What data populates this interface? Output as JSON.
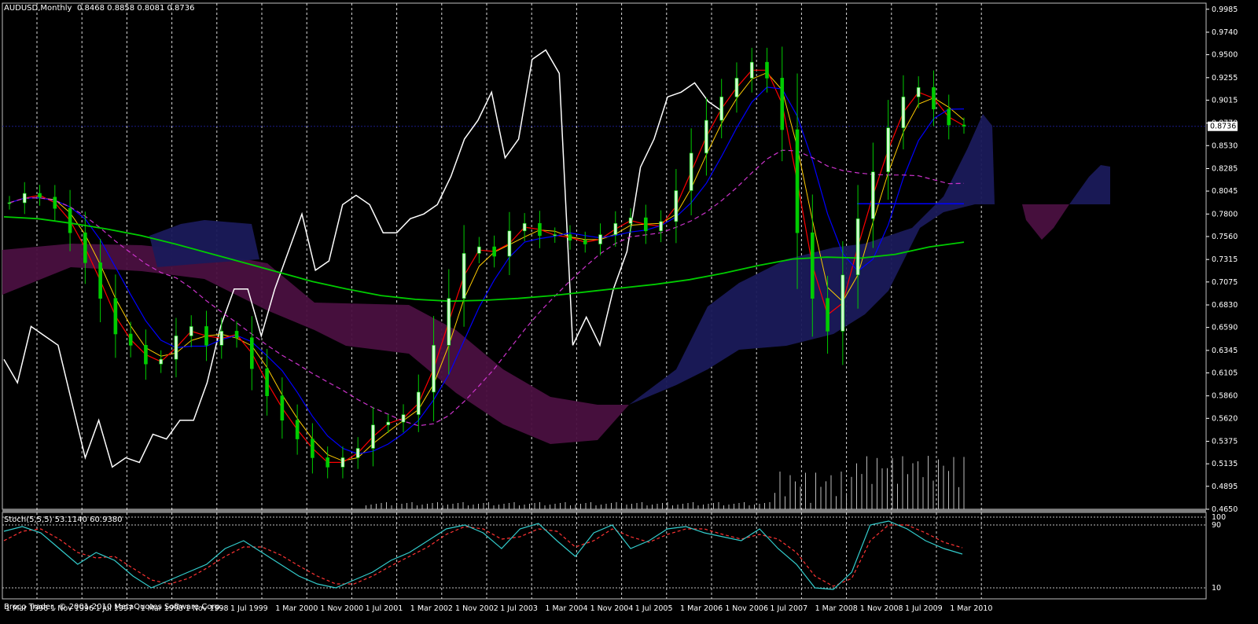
{
  "window": {
    "symbol_label": "AUDUSD,Monthly",
    "ohlc_label": "0.8468 0.8858 0.8081 0.8736",
    "current_price_label": "0.8736",
    "osc_label": "Stoch(5,5,5) 53.1140 60.9380",
    "copyright": "Broco Trader, © 2001-2010 MetaQuotes Software Corp."
  },
  "colors": {
    "background": "#000000",
    "grid": "#ffffff",
    "bull_candle": "#ccffcc",
    "bear_candle": "#00cc00",
    "tenkan": "#ff0000",
    "kijun": "#0000ff",
    "chikou": "#ffffff",
    "ma_fast": "#ffcc00",
    "ma_slow": "#00cc00",
    "ma_dashed": "#cc33cc",
    "cloud_bull": "#1a1a5a",
    "cloud_bear": "#4a1040",
    "stoch_main": "#33cccc",
    "stoch_signal": "#ff3333"
  },
  "chart_data": [
    {
      "type": "line",
      "title": "AUDUSD,Monthly",
      "x_ticks": [
        "1 Mar 1996",
        "1 Nov 1996",
        "1 Jul 1997",
        "1 Mar 1998",
        "1 Nov 1998",
        "1 Jul 1999",
        "1 Mar 2000",
        "1 Nov 2000",
        "1 Jul 2001",
        "1 Mar 2002",
        "1 Nov 2002",
        "1 Jul 2003",
        "1 Mar 2004",
        "1 Nov 2004",
        "1 Jul 2005",
        "1 Mar 2006",
        "1 Nov 2006",
        "1 Jul 2007",
        "1 Mar 2008",
        "1 Nov 2008",
        "1 Jul 2009",
        "1 Mar 2010"
      ],
      "y_ticks": [
        "0.9985",
        "0.9740",
        "0.9500",
        "0.9255",
        "0.9015",
        "0.8770",
        "0.8530",
        "0.8285",
        "0.8045",
        "0.7800",
        "0.7560",
        "0.7315",
        "0.7075",
        "0.6830",
        "0.6590",
        "0.6345",
        "0.6105",
        "0.5860",
        "0.5620",
        "0.5375",
        "0.5135",
        "0.4895",
        "0.4650"
      ],
      "ylim": [
        0.465,
        1.005
      ],
      "series": [
        {
          "name": "close",
          "values": [
            0.792,
            0.802,
            0.798,
            0.786,
            0.76,
            0.728,
            0.69,
            0.652,
            0.64,
            0.62,
            0.625,
            0.65,
            0.66,
            0.64,
            0.655,
            0.648,
            0.615,
            0.586,
            0.56,
            0.54,
            0.52,
            0.51,
            0.52,
            0.53,
            0.555,
            0.558,
            0.566,
            0.59,
            0.64,
            0.69,
            0.738,
            0.745,
            0.735,
            0.762,
            0.77,
            0.757,
            0.758,
            0.752,
            0.748,
            0.758,
            0.77,
            0.776,
            0.762,
            0.772,
            0.805,
            0.845,
            0.88,
            0.905,
            0.925,
            0.942,
            0.925,
            0.87,
            0.76,
            0.69,
            0.655,
            0.715,
            0.775,
            0.825,
            0.872,
            0.905,
            0.915,
            0.892,
            0.875,
            0.8736
          ]
        },
        {
          "name": "chikou",
          "values": [
            0.625,
            0.6,
            0.66,
            0.65,
            0.64,
            0.58,
            0.52,
            0.56,
            0.51,
            0.52,
            0.515,
            0.545,
            0.54,
            0.56,
            0.56,
            0.6,
            0.66,
            0.7,
            0.7,
            0.65,
            0.7,
            0.74,
            0.78,
            0.72,
            0.73,
            0.79,
            0.8,
            0.79,
            0.76,
            0.76,
            0.775,
            0.78,
            0.79,
            0.82,
            0.86,
            0.88,
            0.91,
            0.84,
            0.86,
            0.945,
            0.955,
            0.93,
            0.64,
            0.67,
            0.64,
            0.7,
            0.74,
            0.83,
            0.86,
            0.905,
            0.91,
            0.92,
            0.9,
            0.89
          ]
        },
        {
          "name": "ma_slow",
          "values": [
            0.777,
            0.775,
            0.77,
            0.764,
            0.757,
            0.748,
            0.738,
            0.728,
            0.718,
            0.708,
            0.7,
            0.693,
            0.689,
            0.687,
            0.688,
            0.69,
            0.693,
            0.697,
            0.701,
            0.705,
            0.71,
            0.717,
            0.725,
            0.732,
            0.734,
            0.733,
            0.737,
            0.745,
            0.75
          ]
        }
      ]
    },
    {
      "type": "line",
      "title": "Stoch(5,5,5) 53.1140 60.9380",
      "y_ticks": [
        "100",
        "90",
        "10"
      ],
      "ylim": [
        0,
        100
      ],
      "series": [
        {
          "name": "main",
          "values": [
            82,
            88,
            80,
            60,
            40,
            55,
            45,
            25,
            10,
            20,
            30,
            40,
            60,
            70,
            55,
            40,
            25,
            15,
            10,
            20,
            30,
            45,
            55,
            70,
            85,
            90,
            80,
            60,
            85,
            92,
            70,
            50,
            80,
            90,
            60,
            70,
            85,
            88,
            80,
            75,
            70,
            85,
            60,
            40,
            10,
            8,
            30,
            90,
            95,
            85,
            70,
            60,
            53
          ]
        },
        {
          "name": "signal",
          "values": [
            70,
            82,
            85,
            72,
            55,
            48,
            50,
            35,
            20,
            15,
            22,
            35,
            50,
            62,
            62,
            52,
            38,
            25,
            15,
            15,
            25,
            38,
            50,
            62,
            78,
            88,
            85,
            72,
            75,
            85,
            82,
            62,
            70,
            85,
            75,
            68,
            78,
            85,
            85,
            78,
            72,
            78,
            72,
            55,
            25,
            12,
            22,
            70,
            90,
            90,
            80,
            68,
            61
          ]
        }
      ]
    }
  ]
}
